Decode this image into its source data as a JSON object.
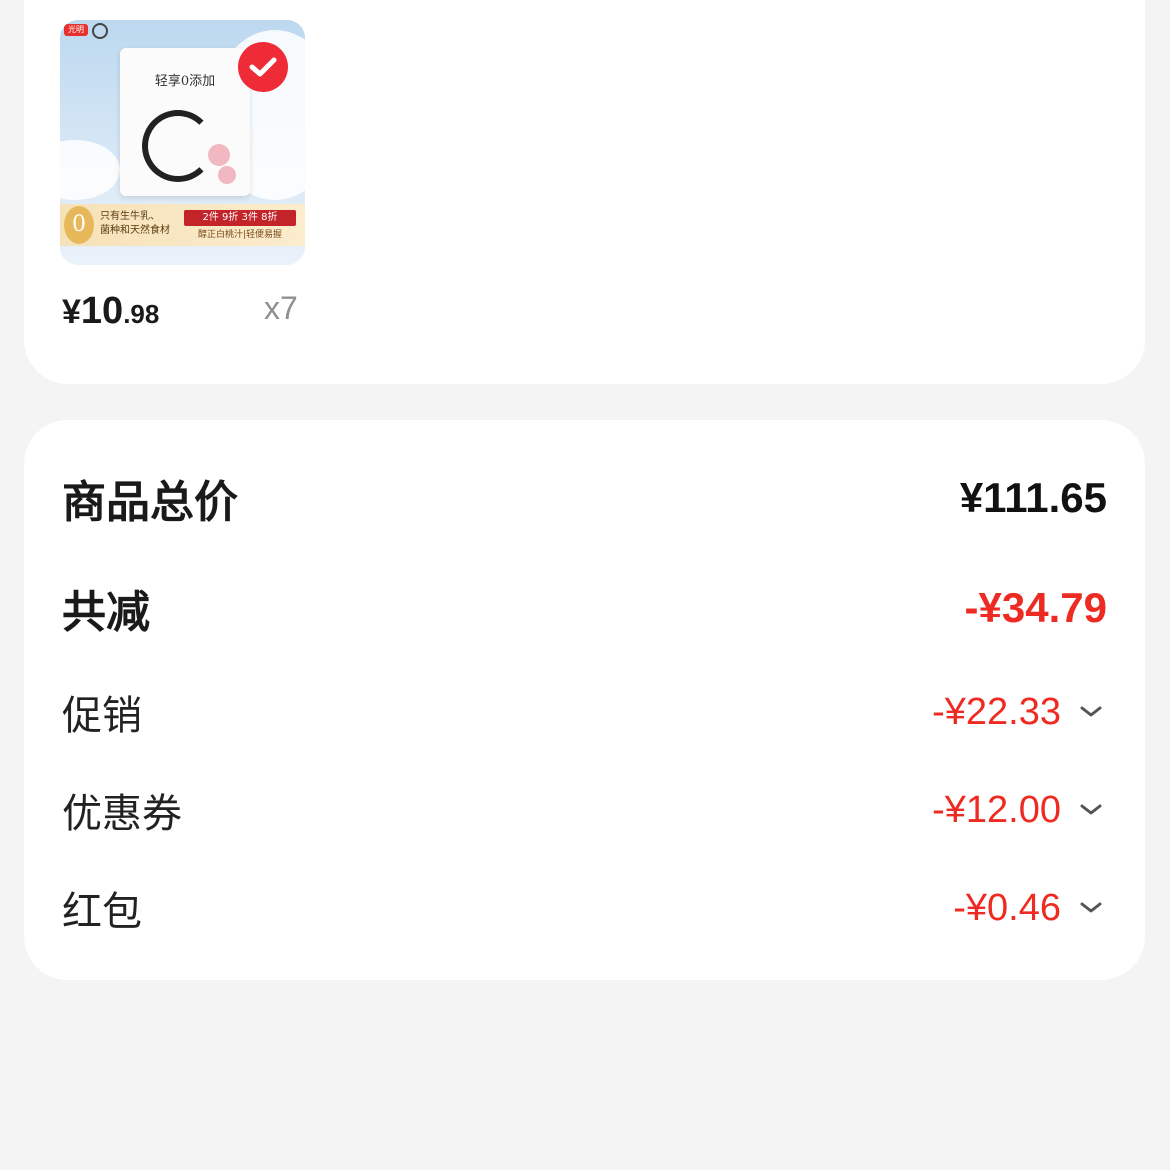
{
  "product": {
    "thumbnail": {
      "brand_logo": "光明",
      "bag_title": "轻享0添加",
      "banner_zero": "0",
      "banner_text_1": "只有生牛乳、",
      "banner_text_2": "菌种和天然食材",
      "promo": "2件 9折 3件 8折",
      "promo_sub": "醇正白桃汁|轻便易握"
    },
    "selected_icon": "check-circle-icon",
    "price_symbol": "¥",
    "price_int": "10",
    "price_dec": ".98",
    "quantity": "x7"
  },
  "summary": {
    "total": {
      "label": "商品总价",
      "value": "¥111.65"
    },
    "discount_total": {
      "label": "共减",
      "value": "-¥34.79"
    },
    "items": [
      {
        "label": "促销",
        "value": "-¥22.33",
        "icon": "chevron-down-icon"
      },
      {
        "label": "优惠券",
        "value": "-¥12.00",
        "icon": "chevron-down-icon"
      },
      {
        "label": "红包",
        "value": "-¥0.46",
        "icon": "chevron-down-icon"
      }
    ]
  },
  "colors": {
    "accent_red": "#ee2b22",
    "background": "#f4f4f4",
    "card": "#ffffff"
  }
}
